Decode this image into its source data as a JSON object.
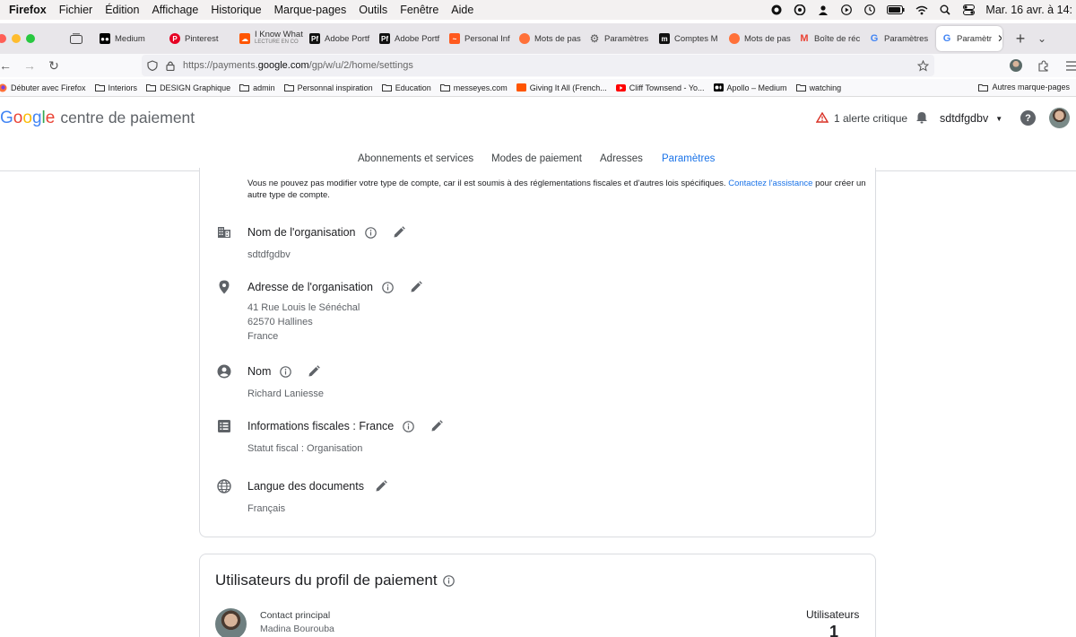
{
  "menubar": {
    "app": "Firefox",
    "items": [
      "Fichier",
      "Édition",
      "Affichage",
      "Historique",
      "Marque-pages",
      "Outils",
      "Fenêtre",
      "Aide"
    ],
    "clock": "Mar. 16 avr. à 14:"
  },
  "tabs": [
    {
      "label": "Medium",
      "icon": "medium-icon",
      "color": "#000000"
    },
    {
      "label": "Pinterest",
      "icon": "pinterest-icon",
      "color": "#e60023"
    },
    {
      "label": "I Know What",
      "sublabel": "LECTURE EN CO",
      "icon": "soundcloud-icon",
      "color": "#ff5500"
    },
    {
      "label": "Adobe Portf",
      "icon": "adobe-portfolio-icon",
      "color": "#111111"
    },
    {
      "label": "Adobe Portf",
      "icon": "adobe-portfolio-icon",
      "color": "#111111"
    },
    {
      "label": "Personal Inf",
      "icon": "behance-icon",
      "color": "#ff5a1f"
    },
    {
      "label": "Mots de pas",
      "icon": "firefox-icon",
      "color": "#ff7139"
    },
    {
      "label": "Paramètres",
      "icon": "gear-icon",
      "color": "#555555"
    },
    {
      "label": "Comptes M",
      "icon": "m-icon",
      "color": "#111111"
    },
    {
      "label": "Mots de pas",
      "icon": "firefox-icon",
      "color": "#ff7139"
    },
    {
      "label": "Boîte de réc",
      "icon": "gmail-icon",
      "color": "#ea4335"
    },
    {
      "label": "Paramètres",
      "icon": "google-icon",
      "color": "#4285f4"
    },
    {
      "label": "Paramètr",
      "icon": "google-icon",
      "color": "#4285f4",
      "active": true
    }
  ],
  "navbar": {
    "url_prefix": "https://payments.",
    "url_domain": "google.com",
    "url_path": "/gp/w/u/2/home/settings"
  },
  "bookmarks": [
    {
      "label": "Débuter avec Firefox",
      "icon": "firefox-icon"
    },
    {
      "label": "Interiors",
      "icon": "folder-icon"
    },
    {
      "label": "DESIGN Graphique",
      "icon": "folder-icon"
    },
    {
      "label": "admin",
      "icon": "folder-icon"
    },
    {
      "label": "Personnal inspiration",
      "icon": "folder-icon"
    },
    {
      "label": "Education",
      "icon": "folder-icon"
    },
    {
      "label": "messeyes.com",
      "icon": "folder-icon"
    },
    {
      "label": "Giving It All (French...",
      "icon": "soundcloud-icon"
    },
    {
      "label": "Cliff Townsend - Yo...",
      "icon": "youtube-icon"
    },
    {
      "label": "Apollo – Medium",
      "icon": "medium-icon"
    },
    {
      "label": "watching",
      "icon": "folder-icon"
    }
  ],
  "bookmarks_other": "Autres marque-pages",
  "header": {
    "product": "centre de paiement",
    "alert": "1 alerte critique",
    "account": "sdtdfgdbv",
    "help": "?"
  },
  "navtabs": [
    {
      "label": "Abonnements et services"
    },
    {
      "label": "Modes de paiement"
    },
    {
      "label": "Adresses"
    },
    {
      "label": "Paramètres",
      "active": true
    }
  ],
  "notice": {
    "text": "Vous ne pouvez pas modifier votre type de compte, car il est soumis à des réglementations fiscales et d'autres lois spécifiques. ",
    "link": "Contactez l'assistance",
    "text_after": " pour créer un autre type de compte."
  },
  "sections": {
    "org_name": {
      "title": "Nom de l'organisation",
      "value": "sdtdfgdbv"
    },
    "org_address": {
      "title": "Adresse de l'organisation",
      "line1": "41 Rue Louis le Sénéchal",
      "line2": "62570 Hallines",
      "line3": "France"
    },
    "name": {
      "title": "Nom",
      "value": "Richard Laniesse"
    },
    "tax": {
      "title": "Informations fiscales : France",
      "value": "Statut fiscal : Organisation"
    },
    "language": {
      "title": "Langue des documents",
      "value": "Français"
    }
  },
  "users_card": {
    "title": "Utilisateurs du profil de paiement",
    "role": "Contact principal",
    "user_name": "Madina Bourouba",
    "count_label": "Utilisateurs",
    "count": "1"
  },
  "colors": {
    "google_blue": "#4285f4",
    "google_red": "#ea4335",
    "google_yellow": "#fbbc05",
    "google_green": "#34a853",
    "link_blue": "#1a73e8",
    "icon_grey": "#5f6368"
  }
}
